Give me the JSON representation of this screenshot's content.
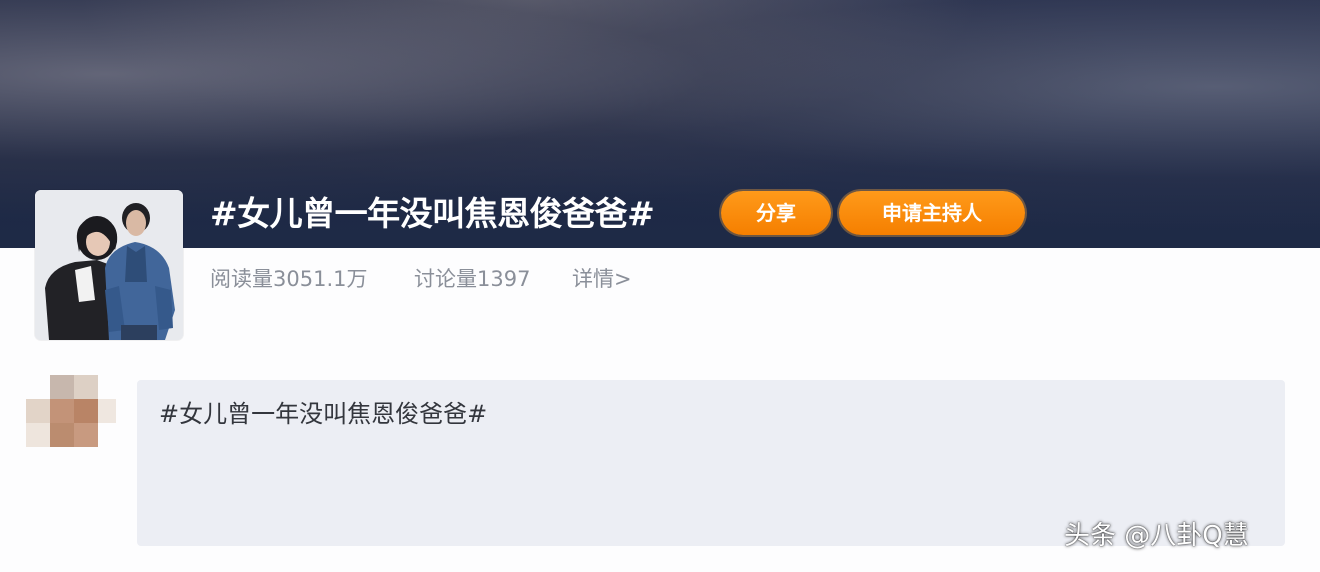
{
  "topic": {
    "title": "#女儿曾一年没叫焦恩俊爸爸#",
    "share_label": "分享",
    "apply_host_label": "申请主持人",
    "stats": {
      "reads": "阅读量3051.1万",
      "discussions": "讨论量1397",
      "details_link": "详情>"
    }
  },
  "post": {
    "text": "#女儿曾一年没叫焦恩俊爸爸#"
  },
  "watermark": {
    "text": "头条 @八卦Q慧"
  },
  "colors": {
    "accent_orange": "#f78a0c",
    "banner_navy": "#1c2744",
    "stats_gray": "#8a8f99",
    "post_bg": "#eceef4"
  },
  "icons": [
    "topic-cover-image",
    "user-avatar-pixelated"
  ]
}
